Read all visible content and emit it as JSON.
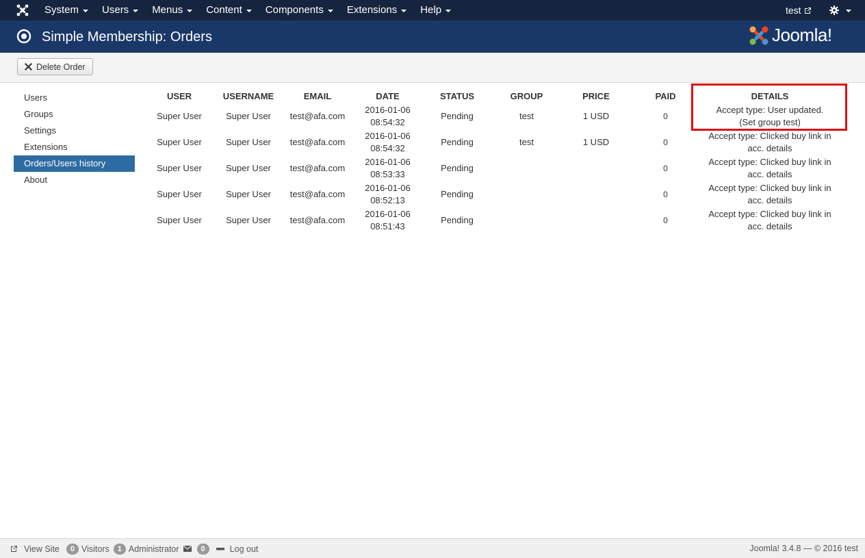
{
  "navbar": {
    "menu": [
      "System",
      "Users",
      "Menus",
      "Content",
      "Components",
      "Extensions",
      "Help"
    ],
    "user_label": "test"
  },
  "subhead": {
    "title": "Simple Membership: Orders",
    "logo_text": "Joomla!"
  },
  "toolbar": {
    "delete_label": "Delete Order"
  },
  "sidebar": {
    "items": [
      "Users",
      "Groups",
      "Settings",
      "Extensions",
      "Orders/Users history",
      "About"
    ],
    "active": "Orders/Users history"
  },
  "table": {
    "headers": [
      "USER",
      "USERNAME",
      "EMAIL",
      "DATE",
      "STATUS",
      "GROUP",
      "PRICE",
      "PAID",
      "DETAILS"
    ],
    "rows": [
      {
        "user": "Super User",
        "username": "Super User",
        "email": "test@afa.com",
        "date": "2016-01-06",
        "time": "08:54:32",
        "status": "Pending",
        "group": "test",
        "price": "1 USD",
        "paid": "0",
        "details": "Accept type: User updated.(Set group test)"
      },
      {
        "user": "Super User",
        "username": "Super User",
        "email": "test@afa.com",
        "date": "2016-01-06",
        "time": "08:54:32",
        "status": "Pending",
        "group": "test",
        "price": "1 USD",
        "paid": "0",
        "details": "Accept type: Clicked buy link in acc. details"
      },
      {
        "user": "Super User",
        "username": "Super User",
        "email": "test@afa.com",
        "date": "2016-01-06",
        "time": "08:53:33",
        "status": "Pending",
        "group": "",
        "price": "",
        "paid": "0",
        "details": "Accept type: Clicked buy link in acc. details"
      },
      {
        "user": "Super User",
        "username": "Super User",
        "email": "test@afa.com",
        "date": "2016-01-06",
        "time": "08:52:13",
        "status": "Pending",
        "group": "",
        "price": "",
        "paid": "0",
        "details": "Accept type: Clicked buy link in acc. details"
      },
      {
        "user": "Super User",
        "username": "Super User",
        "email": "test@afa.com",
        "date": "2016-01-06",
        "time": "08:51:43",
        "status": "Pending",
        "group": "",
        "price": "",
        "paid": "0",
        "details": "Accept type: Clicked buy link in acc. details"
      }
    ]
  },
  "footer": {
    "view_site": "View Site",
    "visitors_count": "0",
    "visitors_label": "Visitors",
    "admin_count": "1",
    "admin_label": "Administrator",
    "messages_count": "0",
    "logout": "Log out",
    "version": "Joomla! 3.4.8 — © 2016 test"
  },
  "colors": {
    "navbar_bg": "#16253f",
    "subhead_bg": "#1a3867",
    "active_item": "#2d6ca2",
    "highlight": "#e01010"
  }
}
